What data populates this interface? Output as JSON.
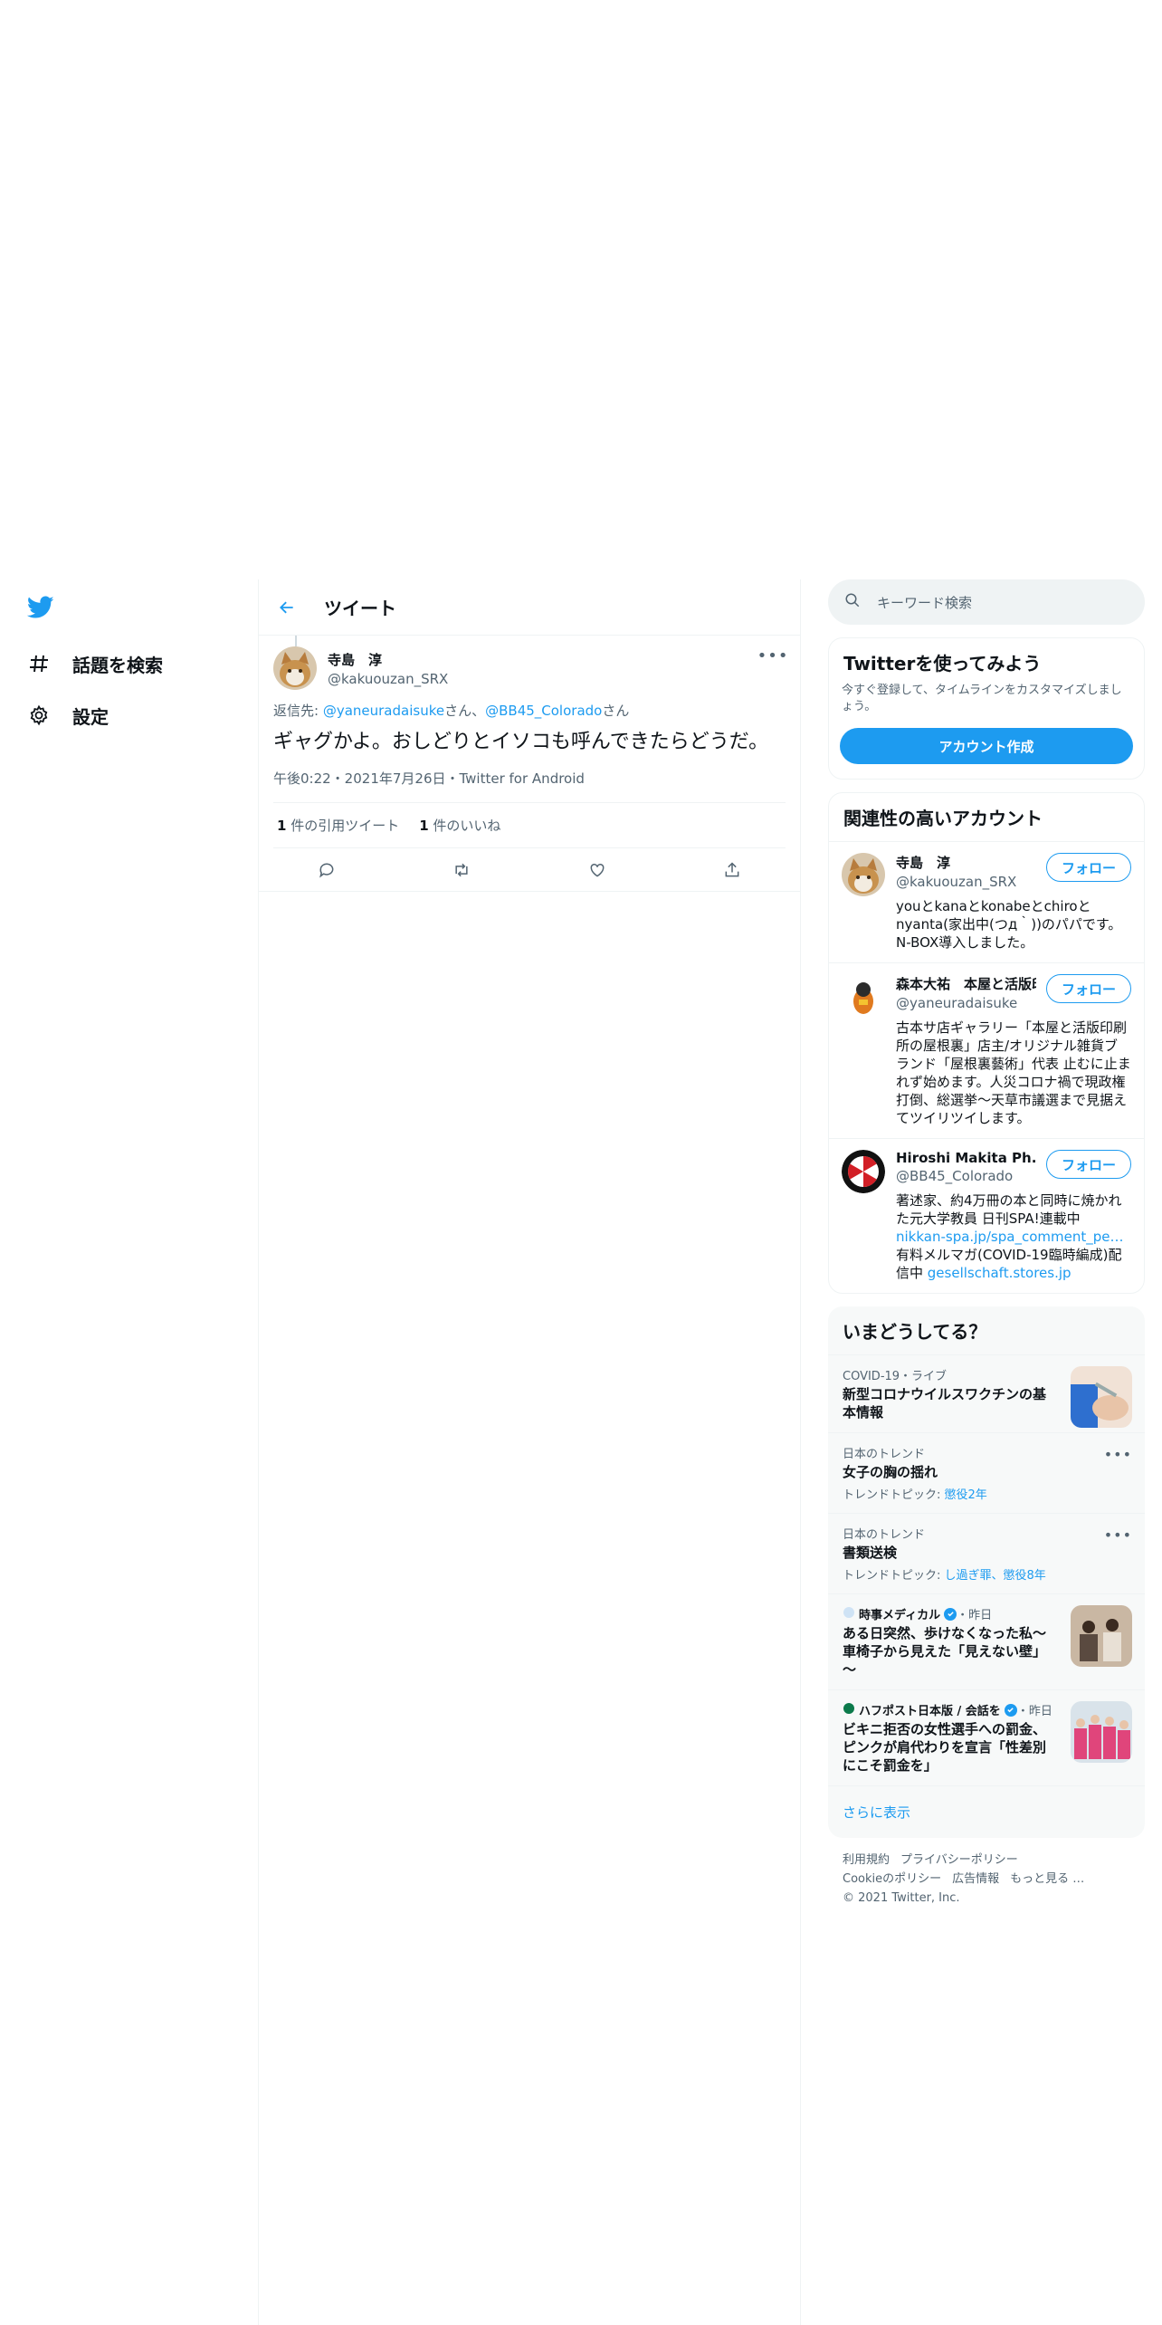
{
  "nav": {
    "items": [
      {
        "label": "話題を検索",
        "icon": "hashtag-icon"
      },
      {
        "label": "設定",
        "icon": "gear-icon"
      }
    ]
  },
  "header": {
    "title": "ツイート"
  },
  "tweet": {
    "author_name": "寺島　淳",
    "author_handle": "@kakuouzan_SRX",
    "reply_prefix": "返信先: ",
    "reply_to_1": "@yaneuradaisuke",
    "reply_san_1": "さん、",
    "reply_to_2": "@BB45_Colorado",
    "reply_san_2": "さん",
    "text": "ギャグかよ。おしどりとイソコも呼んできたらどうだ。",
    "meta": "午後0:22・2021年7月26日・Twitter for Android",
    "quote_count": "1",
    "quote_label": " 件の引用ツイート",
    "like_count": "1",
    "like_label": " 件のいいね"
  },
  "search": {
    "placeholder": "キーワード検索"
  },
  "signup": {
    "title": "Twitterを使ってみよう",
    "subtitle": "今すぐ登録して、タイムラインをカスタマイズしましょう。",
    "button": "アカウント作成"
  },
  "related": {
    "title": "関連性の高いアカウント",
    "follow_label": "フォロー",
    "accounts": [
      {
        "name": "寺島　淳",
        "handle": "@kakuouzan_SRX",
        "bio": "youとkanaとkonabeとchiroとnyanta(家出中(つд｀))のパパです。N-BOX導入しました。"
      },
      {
        "name": "森本大祐　本屋と活版印",
        "handle": "@yaneuradaisuke",
        "bio": "古本サ店ギャラリー「本屋と活版印刷所の屋根裏」店主/オリジナル雑貨ブランド「屋根裏藝術」代表 止むに止まれず始めます。人災コロナ禍で現政権打倒、総選挙～天草市議選まで見据えてツイリツイします。"
      },
      {
        "name": "Hiroshi Makita Ph.D.",
        "handle": "@BB45_Colorado",
        "bio_1": "著述家、約4万冊の本と同時に焼かれた元大学教員 日刊SPA!連載中 ",
        "bio_link_1": "nikkan-spa.jp/spa_comment_pe…",
        "bio_2": " 有料メルマガ(COVID-19臨時編成)配信中 ",
        "bio_link_2": "gesellschaft.stores.jp"
      }
    ]
  },
  "trends": {
    "title": "いまどうしてる？",
    "items": [
      {
        "context": "COVID-19・ライブ",
        "title": "新型コロナウイルスワクチンの基本情報"
      },
      {
        "context": "日本のトレンド",
        "title": "女子の胸の揺れ",
        "topic_prefix": "トレンドトピック: ",
        "topic": "懲役2年"
      },
      {
        "context": "日本のトレンド",
        "title": "書類送検",
        "topic_prefix": "トレンドトピック: ",
        "topic": "し過ぎ罪、懲役8年"
      },
      {
        "source": "時事メディカル",
        "time": "・昨日",
        "title": "ある日突然、歩けなくなった私～車椅子から見えた「見えない壁」～"
      },
      {
        "source": "ハフポスト日本版 / 会話を",
        "time": "・昨日",
        "title": "ビキニ拒否の女性選手への罰金、ピンクが肩代わりを宣言「性差別にこそ罰金を」"
      }
    ],
    "show_more": "さらに表示"
  },
  "footer": {
    "links": [
      "利用規約",
      "プライバシーポリシー",
      "Cookieのポリシー",
      "広告情報",
      "もっと見る …"
    ],
    "copyright": "© 2021 Twitter, Inc."
  },
  "colors": {
    "accent": "#1d9bf0",
    "text": "#0f1419",
    "muted": "#536471",
    "border": "#eff3f4"
  }
}
